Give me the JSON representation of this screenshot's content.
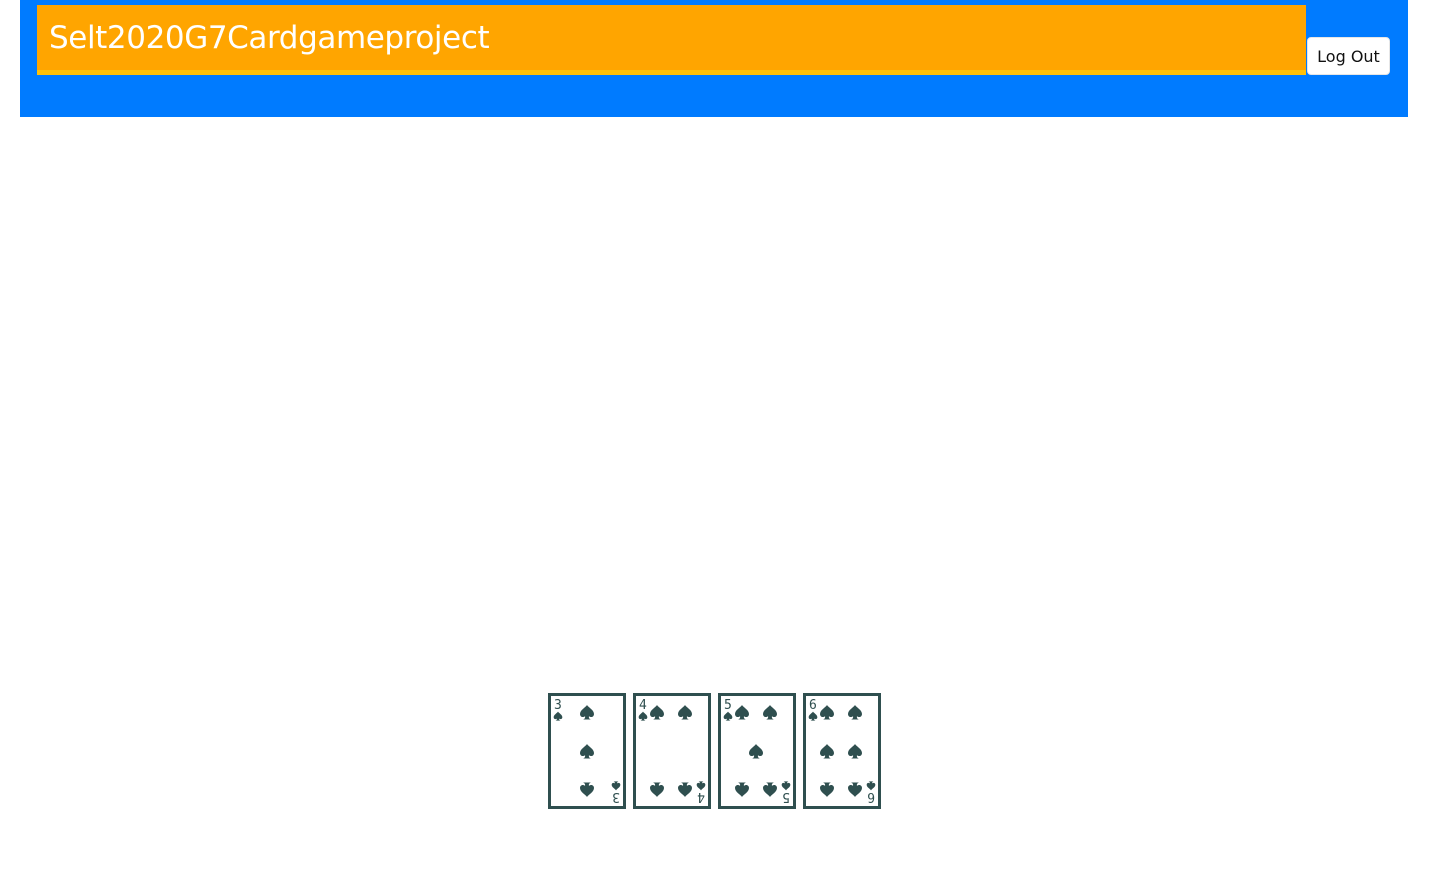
{
  "header": {
    "title": "Selt2020G7Cardgameproject",
    "logout_label": "Log Out",
    "colors": {
      "nav": "#007bff",
      "title_bar": "#ffa500",
      "title_underline": "#ffc107"
    }
  },
  "hand": {
    "cards": [
      {
        "rank": "3",
        "suit": "spades",
        "pips": 3
      },
      {
        "rank": "4",
        "suit": "spades",
        "pips": 4
      },
      {
        "rank": "5",
        "suit": "spades",
        "pips": 5
      },
      {
        "rank": "6",
        "suit": "spades",
        "pips": 6
      }
    ],
    "card_color": "#2f4f4f"
  }
}
